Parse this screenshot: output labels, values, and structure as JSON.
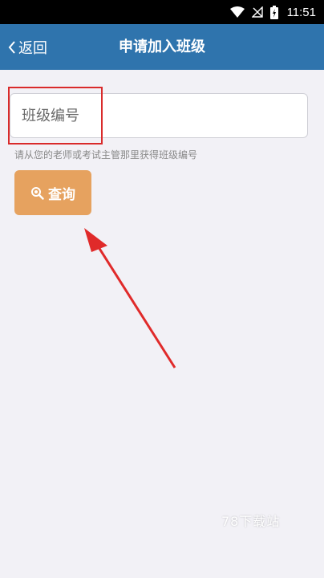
{
  "status_bar": {
    "time": "11:51",
    "icons": [
      "wifi-icon",
      "no-signal-icon",
      "battery-icon"
    ]
  },
  "nav": {
    "back_label": "返回",
    "title": "申请加入班级"
  },
  "form": {
    "class_input_placeholder": "班级编号",
    "class_input_value": "",
    "hint": "请从您的老师或考试主管那里获得班级编号",
    "query_label": "查询"
  },
  "watermark": "78下载站",
  "colors": {
    "nav_bar": "#2f74ad",
    "query_button": "#e6a25f",
    "highlight": "#d92b2b",
    "background": "#f2f1f6"
  }
}
